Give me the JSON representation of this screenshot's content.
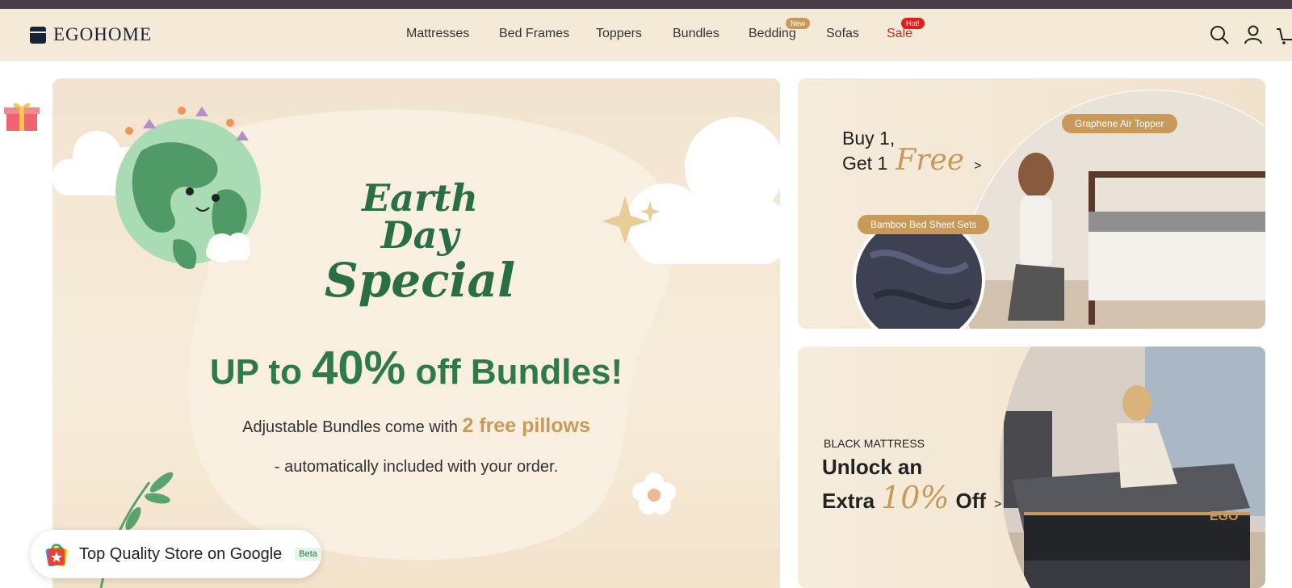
{
  "brand": {
    "name": "EGOHOME"
  },
  "nav": {
    "items": [
      {
        "label": "Mattresses"
      },
      {
        "label": "Bed Frames"
      },
      {
        "label": "Toppers"
      },
      {
        "label": "Bundles"
      },
      {
        "label": "Bedding",
        "badge": "New"
      },
      {
        "label": "Sofas"
      },
      {
        "label": "Sale",
        "badge": "Hot!"
      }
    ]
  },
  "header_icons": [
    "search-icon",
    "account-icon",
    "cart-icon"
  ],
  "hero": {
    "title_line1": "Earth Day",
    "title_line2": "Special",
    "headline_pre": "UP to ",
    "headline_big": "40%",
    "headline_post": " off Bundles!",
    "sub_pre": "Adjustable Bundles come with ",
    "sub_accent": "2 free pillows",
    "sub_line2": "- automatically included with your order."
  },
  "card1": {
    "line1": "Buy 1,",
    "line2": "Get 1",
    "free": "Free",
    "arrow": ">",
    "pill_topper": "Graphene Air Topper",
    "pill_sheets": "Bamboo Bed Sheet Sets"
  },
  "card2": {
    "eyebrow": "BLACK MATTRESS",
    "line1": "Unlock an",
    "line2_pre": "Extra ",
    "pct": "10%",
    "line2_post": " Off",
    "arrow": ">",
    "product_logo": "EGO"
  },
  "google_badge": {
    "text": "Top Quality Store on Google",
    "beta": "Beta"
  },
  "colors": {
    "accent": "#c9995a",
    "green": "#2f7a4a",
    "sale": "#e0201c",
    "header_bg": "#f5ead7"
  }
}
